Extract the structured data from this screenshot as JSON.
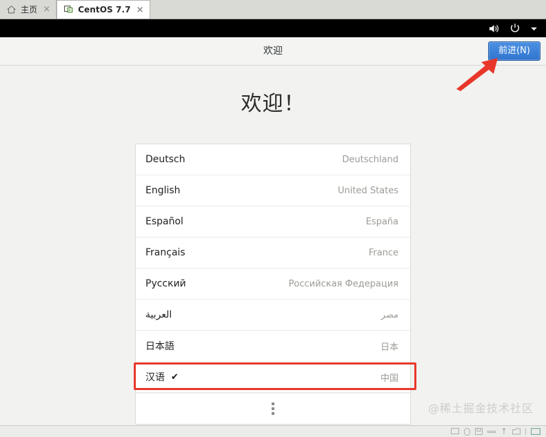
{
  "window": {
    "tabs": [
      {
        "label": "主页",
        "icon": "home-icon",
        "active": false,
        "close": "×"
      },
      {
        "label": "CentOS 7.7",
        "icon": "vm-screen-icon",
        "active": true,
        "close": "×"
      }
    ]
  },
  "system_bar": {
    "icons": [
      "volume-icon",
      "power-icon",
      "chevron-down-icon"
    ],
    "background": "#000000"
  },
  "header": {
    "title": "欢迎",
    "next_button": "前进(N)",
    "next_button_color": "#3176cf"
  },
  "main": {
    "heading": "欢迎！",
    "language_list": {
      "rows": [
        {
          "name": "Deutsch",
          "region": "Deutschland",
          "selected": false
        },
        {
          "name": "English",
          "region": "United States",
          "selected": false
        },
        {
          "name": "Español",
          "region": "España",
          "selected": false
        },
        {
          "name": "Français",
          "region": "France",
          "selected": false
        },
        {
          "name": "Русский",
          "region": "Российская Федерация",
          "selected": false
        },
        {
          "name": "العربية",
          "region": "مصر",
          "selected": false
        },
        {
          "name": "日本語",
          "region": "日本",
          "selected": false
        },
        {
          "name": "汉语",
          "region": "中国",
          "selected": true
        }
      ],
      "selected_check": "✔",
      "more_indicator": "more-options-icon"
    }
  },
  "annotations": {
    "highlight_color": "#e8372a",
    "arrow": "red-arrow-pointing-to-next-button",
    "box_target": "汉语"
  },
  "watermark": "@稀土掘金技术社区"
}
